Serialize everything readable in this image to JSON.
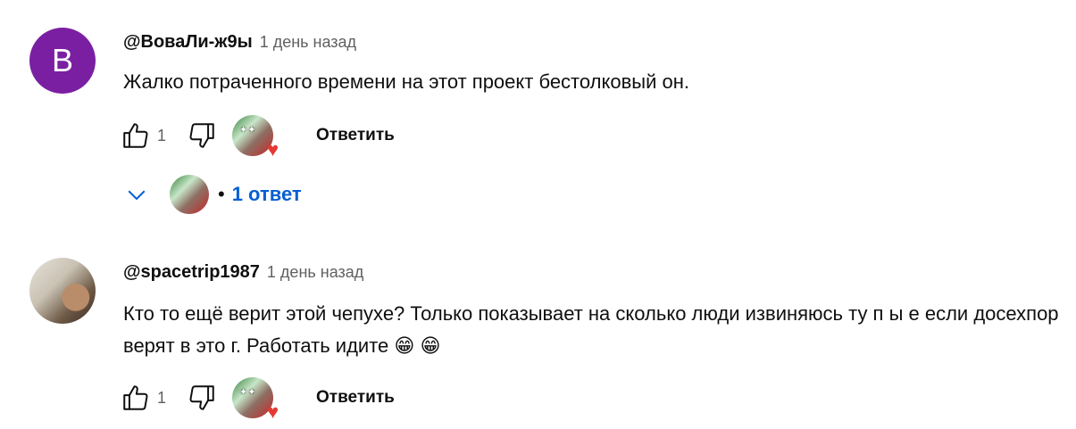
{
  "comments": [
    {
      "avatar_letter": "B",
      "author": "@ВоваЛи-ж9ы",
      "time": "1 день назад",
      "text": "Жалко потраченного времени на этот проект бестолковый он.",
      "likes": "1",
      "reply_label": "Ответить",
      "replies_label": "1 ответ"
    },
    {
      "author": "@spacetrip1987",
      "time": "1 день назад",
      "text": "Кто то ещё верит этой чепухе? Только показывает на сколько люди извиняюсь ту п ы е если досехпор верят в это г. Работать идите",
      "emojis": "😁 😁",
      "likes": "1",
      "reply_label": "Ответить"
    }
  ],
  "icons": {
    "like": "thumb-up-icon",
    "dislike": "thumb-down-icon",
    "heart": "heart-icon",
    "expand": "chevron-down-icon"
  },
  "colors": {
    "link_blue": "#065fd4",
    "avatar_purple": "#7b1fa2",
    "heart_red": "#e53935"
  }
}
